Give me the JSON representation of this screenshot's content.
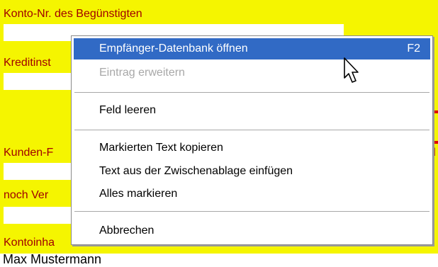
{
  "form": {
    "labels": {
      "konto": "Konto-Nr. des Begünstigten",
      "kreditinstitut": "Kreditinst",
      "kunden_referenz": "Kunden-F",
      "kunden_tail": "nd",
      "noch_verwendungszweck": "noch Ver",
      "kontoinhaber": "Kontoinha"
    },
    "kontoinhaber_value": "Max Mustermann"
  },
  "context_menu": {
    "items": [
      {
        "label": "Empfänger-Datenbank öffnen",
        "shortcut": "F2",
        "state": "highlighted"
      },
      {
        "label": "Eintrag erweitern",
        "shortcut": "",
        "state": "disabled"
      },
      {
        "label": "Feld leeren",
        "shortcut": "",
        "state": "normal"
      },
      {
        "label": "Markierten Text kopieren",
        "shortcut": "",
        "state": "normal"
      },
      {
        "label": "Text aus der Zwischenablage einfügen",
        "shortcut": "",
        "state": "normal"
      },
      {
        "label": "Alles markieren",
        "shortcut": "",
        "state": "normal"
      },
      {
        "label": "Abbrechen",
        "shortcut": "",
        "state": "normal"
      }
    ]
  },
  "colors": {
    "form_background": "#f5f500",
    "label_text": "#a00000",
    "highlight": "#316ac5",
    "accent_line": "#e00000"
  },
  "icons": {
    "pointer": "mouse-pointer-icon"
  }
}
